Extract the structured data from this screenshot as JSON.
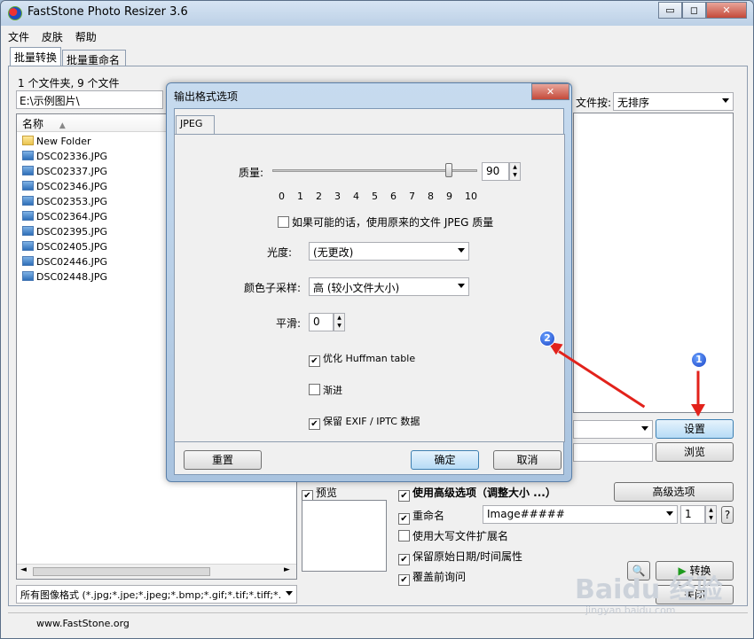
{
  "window": {
    "title": "FastStone Photo Resizer 3.6",
    "min": "▭",
    "max": "◻",
    "close": "✕"
  },
  "menu": [
    "文件",
    "皮肤",
    "帮助"
  ],
  "tabs": [
    "批量转换",
    "批量重命名"
  ],
  "left": {
    "summary": "1 个文件夹, 9 个文件",
    "path": "E:\\示例图片\\",
    "column": "名称",
    "files": [
      "New Folder",
      "DSC02336.JPG",
      "DSC02337.JPG",
      "DSC02346.JPG",
      "DSC02353.JPG",
      "DSC02364.JPG",
      "DSC02395.JPG",
      "DSC02405.JPG",
      "DSC02446.JPG",
      "DSC02448.JPG"
    ],
    "filter": "所有图像格式 (*.jpg;*.jpe;*.jpeg;*.bmp;*.gif;*.tif;*.tiff;*."
  },
  "right": {
    "sort_label": "文件按:",
    "sort_value": "无排序",
    "settings_btn": "设置",
    "browse_btn": "浏览",
    "preview": "预览",
    "advanced": "使用高级选项（调整大小 ...）",
    "advanced_btn": "高级选项",
    "rename": "重命名",
    "rename_pattern": "Image#####",
    "rename_start": "1",
    "help": "?",
    "upper_ext": "使用大写文件扩展名",
    "keep_date": "保留原始日期/时间属性",
    "overwrite": "覆盖前询问",
    "convert_btn": "转换",
    "close_btn": "关闭"
  },
  "status": {
    "site": "www.FastStone.org"
  },
  "dialog": {
    "title": "输出格式选项",
    "tab": "JPEG",
    "quality_label": "质量:",
    "quality_value": "90",
    "quality_level": 9,
    "ticks": [
      "0",
      "1",
      "2",
      "3",
      "4",
      "5",
      "6",
      "7",
      "8",
      "9",
      "10"
    ],
    "use_original": "如果可能的话，使用原来的文件 JPEG 质量",
    "brightness_label": "光度:",
    "brightness_value": "(无更改)",
    "subsample_label": "颜色子采样:",
    "subsample_value": "高 (较小文件大小)",
    "smooth_label": "平滑:",
    "smooth_value": "0",
    "huffman": "优化 Huffman table",
    "progressive": "渐进",
    "exif": "保留 EXIF / IPTC 数据",
    "reset_btn": "重置",
    "ok_btn": "确定",
    "cancel_btn": "取消"
  },
  "annotations": {
    "badge1": "1",
    "badge2": "2"
  },
  "watermark": {
    "logo": "Baidu 经验",
    "url": "jingyan.baidu.com"
  }
}
